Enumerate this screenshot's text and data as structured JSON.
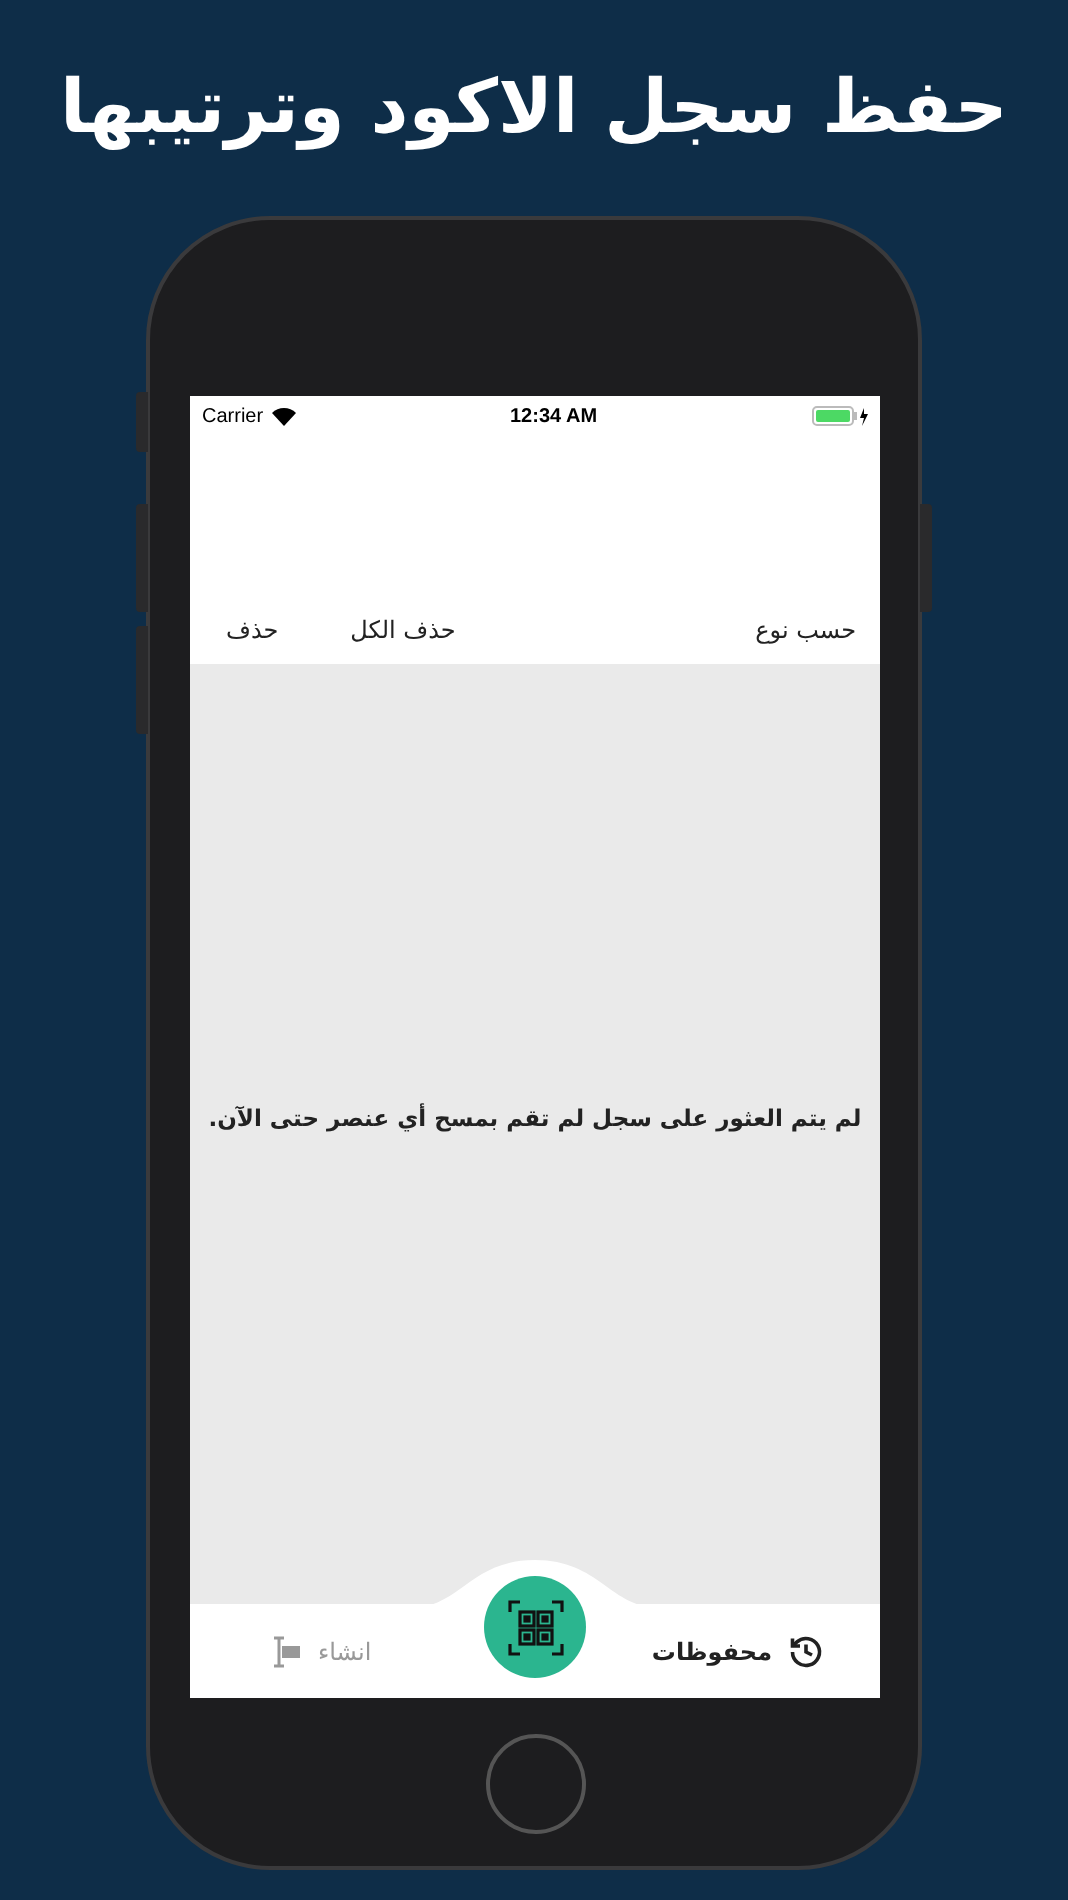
{
  "headline": "حفظ سجل الاكود وترتيبها",
  "status_bar": {
    "carrier": "Carrier",
    "time": "12:34 AM"
  },
  "toolbar": {
    "actions": [
      {
        "label": "حذف الكل"
      },
      {
        "label": "حذف"
      }
    ],
    "sort": "حسب نوع"
  },
  "empty_message": "لم يتم العثور على سجل لم تقم بمسح أي عنصر حتى الآن.",
  "tab_bar": {
    "tabs": [
      {
        "kind": "saved",
        "label": "محفوظات",
        "selected": true
      },
      {
        "kind": "create",
        "label": "انشاء",
        "selected": false
      }
    ]
  }
}
